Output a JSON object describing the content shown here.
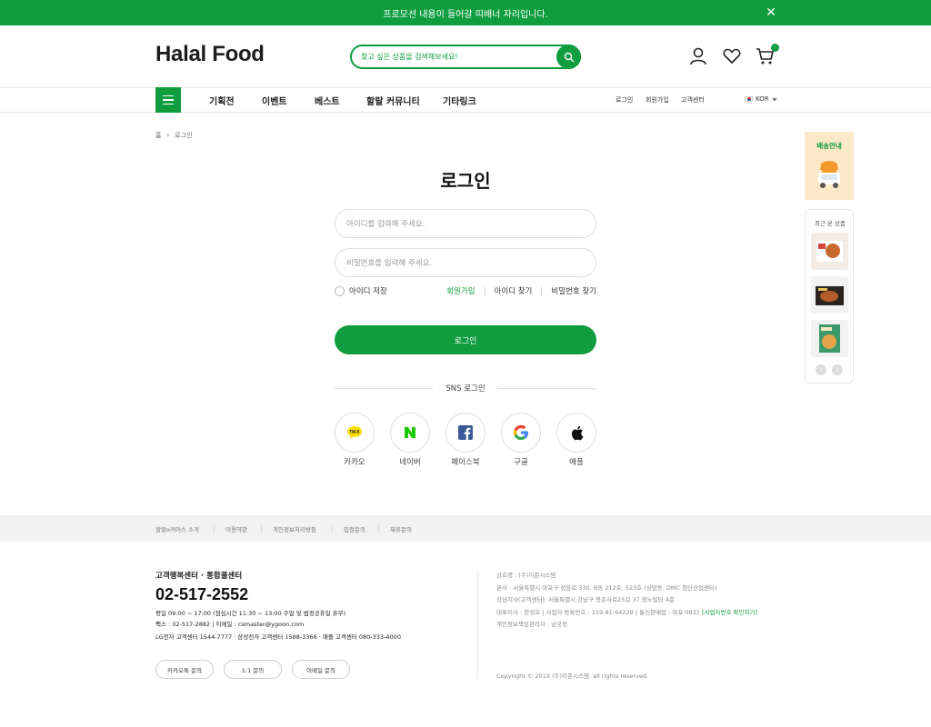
{
  "promo": {
    "text": "프로모션 내용이 들어갈 띠배너 자리입니다."
  },
  "header": {
    "logo": "Halal Food",
    "search_placeholder": "찾고 싶은 상품을 검색해보세요!"
  },
  "nav": {
    "items": [
      "기획전",
      "이벤트",
      "베스트",
      "할랄 커뮤니티",
      "기타링크"
    ],
    "util": [
      "로그인",
      "회원가입",
      "고객센터"
    ],
    "lang": "KOR"
  },
  "breadcrumb": {
    "home": "홈",
    "current": "로그인"
  },
  "login": {
    "title": "로그인",
    "id_placeholder": "아이디를 입력해 주세요.",
    "pw_placeholder": "비밀번호를 입력해 주세요.",
    "save_id": "아이디 저장",
    "join": "회원가입",
    "find_id": "아이디 찾기",
    "find_pw": "비밀번호 찾기",
    "button": "로그인",
    "sns_title": "SNS 로그인",
    "sns": [
      {
        "label": "카카오",
        "icon": "kakao-icon"
      },
      {
        "label": "네이버",
        "icon": "naver-icon"
      },
      {
        "label": "페이스북",
        "icon": "facebook-icon"
      },
      {
        "label": "구글",
        "icon": "google-icon"
      },
      {
        "label": "애플",
        "icon": "apple-icon"
      }
    ]
  },
  "side": {
    "banner": "배송안내",
    "recent_title": "최근 본 상품"
  },
  "footer": {
    "nav": [
      "할랄e커머스 소개",
      "이용약관",
      "개인정보처리방침",
      "입점문의",
      "제휴문의"
    ],
    "cs_title": "고객행복센터 · 통합콜센터",
    "phone": "02-517-2552",
    "hours": "평일 09:00 ~ 17:00 (점심시간 11:30 ~ 13:00 주말 및 법정공휴일 휴무)",
    "fax": "팩스 : 02-517-2882  |  이메일 : csmaster@ygoon.com",
    "centers": "LG전자 고객센터 1544-7777 · 삼성전자 고객센터 1588-3366 · 애플 고객센터 080-333-4000",
    "buttons": [
      "카카오톡 문의",
      "1:1 문의",
      "이메일 문의"
    ],
    "company": "상호명 : (주)이준시스템",
    "hq": "본사 : 서울특별시 마포구 성암로 330, B동 212호, 523호 (상암동, DMC 첨단산업센터)",
    "branch": "강남지사(고객센터): 서울특별시 강남구 봉은사로25길 37 정노빌딩 4층",
    "ceo_prefix": "대표이사 : 한성호  |  사업자 등록번호 : 119-81-64229  |  통신판매업 : 마포 0831 ",
    "ceo_link": "[사업자번호 확인하기]",
    "privacy": "개인정보책임관리자 : 남궁정",
    "copyright": "Copyright © 2019 (주)이준시스템. all rights reserved."
  },
  "colors": {
    "accent": "#0f9d3f"
  }
}
